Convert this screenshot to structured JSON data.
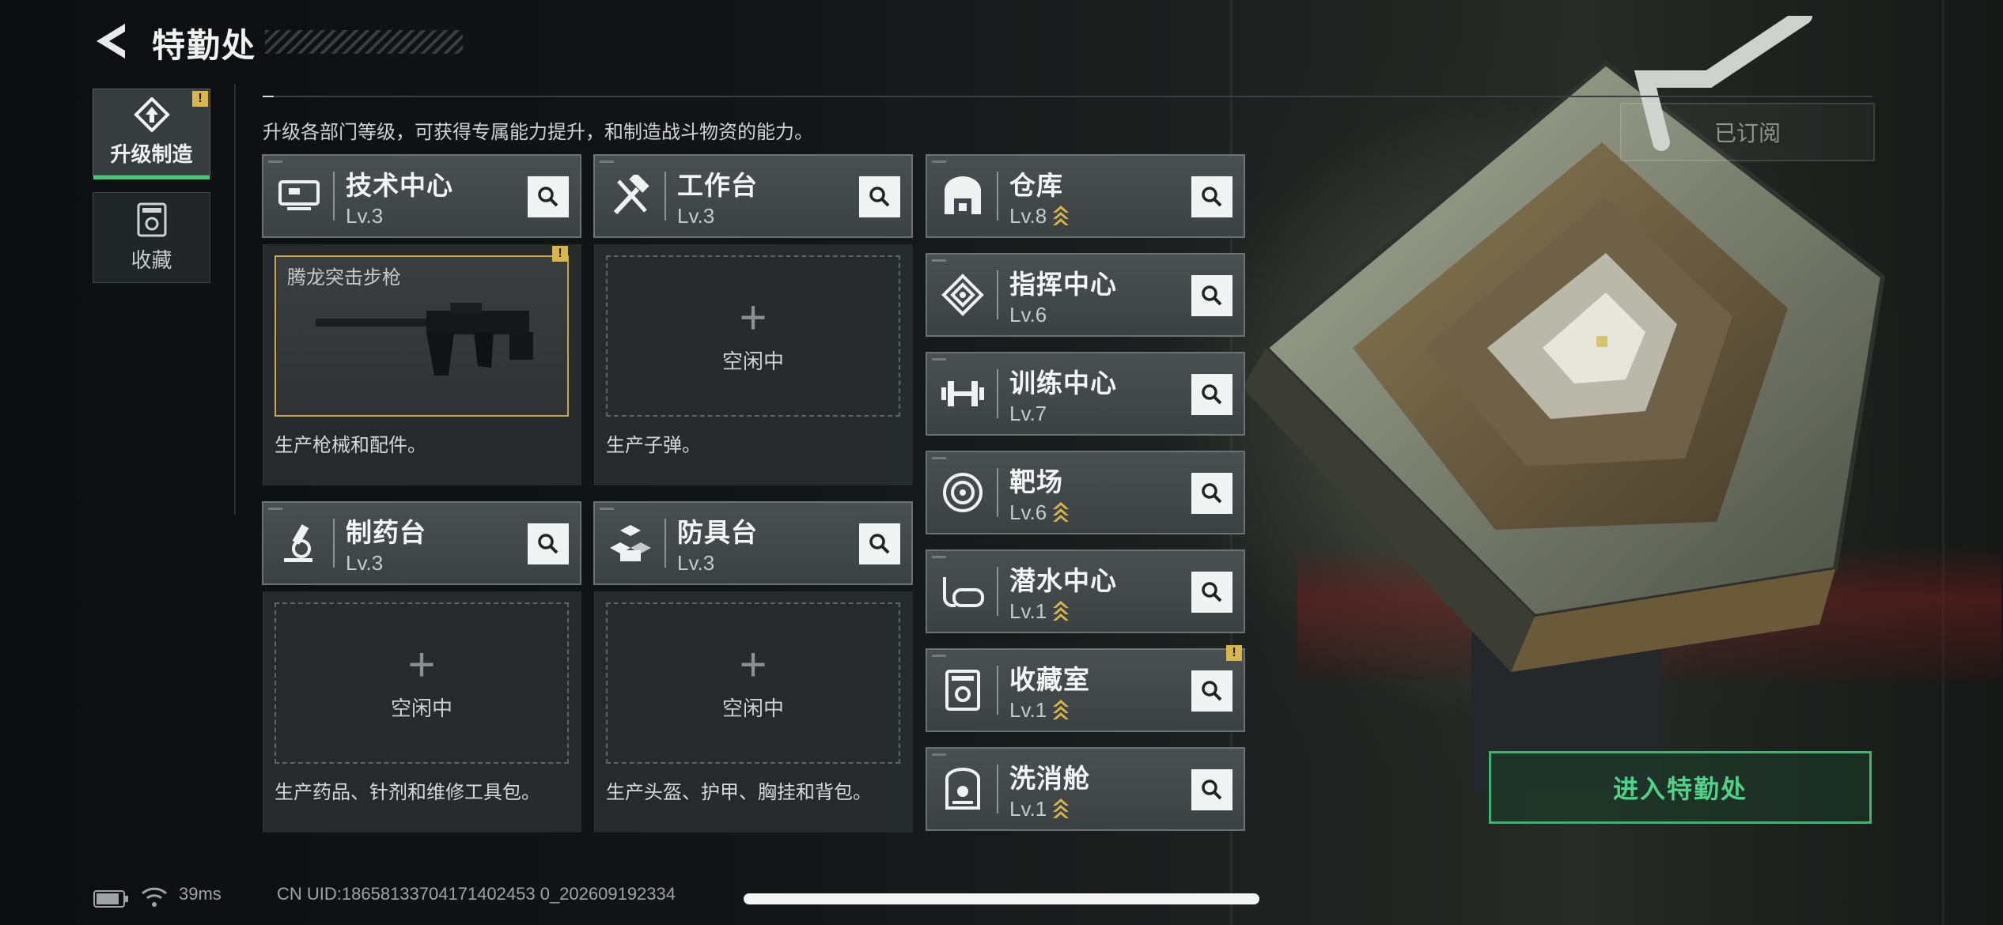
{
  "header": {
    "title": "特勤处"
  },
  "sidebar": {
    "tabs": [
      {
        "label": "升级制造",
        "active": true,
        "alert": "!"
      },
      {
        "label": "收藏",
        "active": false
      }
    ]
  },
  "description": "升级各部门等级，可获得专属能力提升，和制造战斗物资的能力。",
  "subscribed_label": "已订阅",
  "production": [
    {
      "name": "技术中心",
      "level": "Lv.3",
      "slot_item": "腾龙突击步枪",
      "slot_alert": "!",
      "desc": "生产枪械和配件。"
    },
    {
      "name": "工作台",
      "level": "Lv.3",
      "slot_status": "空闲中",
      "desc": "生产子弹。"
    },
    {
      "name": "制药台",
      "level": "Lv.3",
      "slot_status": "空闲中",
      "desc": "生产药品、针剂和维修工具包。"
    },
    {
      "name": "防具台",
      "level": "Lv.3",
      "slot_status": "空闲中",
      "desc": "生产头盔、护甲、胸挂和背包。"
    }
  ],
  "facilities": [
    {
      "name": "仓库",
      "level": "Lv.8",
      "upgradable": true
    },
    {
      "name": "指挥中心",
      "level": "Lv.6",
      "upgradable": false
    },
    {
      "name": "训练中心",
      "level": "Lv.7",
      "upgradable": false
    },
    {
      "name": "靶场",
      "level": "Lv.6",
      "upgradable": true
    },
    {
      "name": "潜水中心",
      "level": "Lv.1",
      "upgradable": true
    },
    {
      "name": "收藏室",
      "level": "Lv.1",
      "upgradable": true,
      "alert": "!"
    },
    {
      "name": "洗消舱",
      "level": "Lv.1",
      "upgradable": true
    }
  ],
  "enter_button": "进入特勤处",
  "status_bar": {
    "ping": "39ms",
    "uid": "CN UID:18658133704171402453 0_202609192334"
  },
  "colors": {
    "accent_green": "#3ecb7a",
    "alert_yellow": "#d8b64a",
    "slot_gold": "#c9a64d"
  }
}
